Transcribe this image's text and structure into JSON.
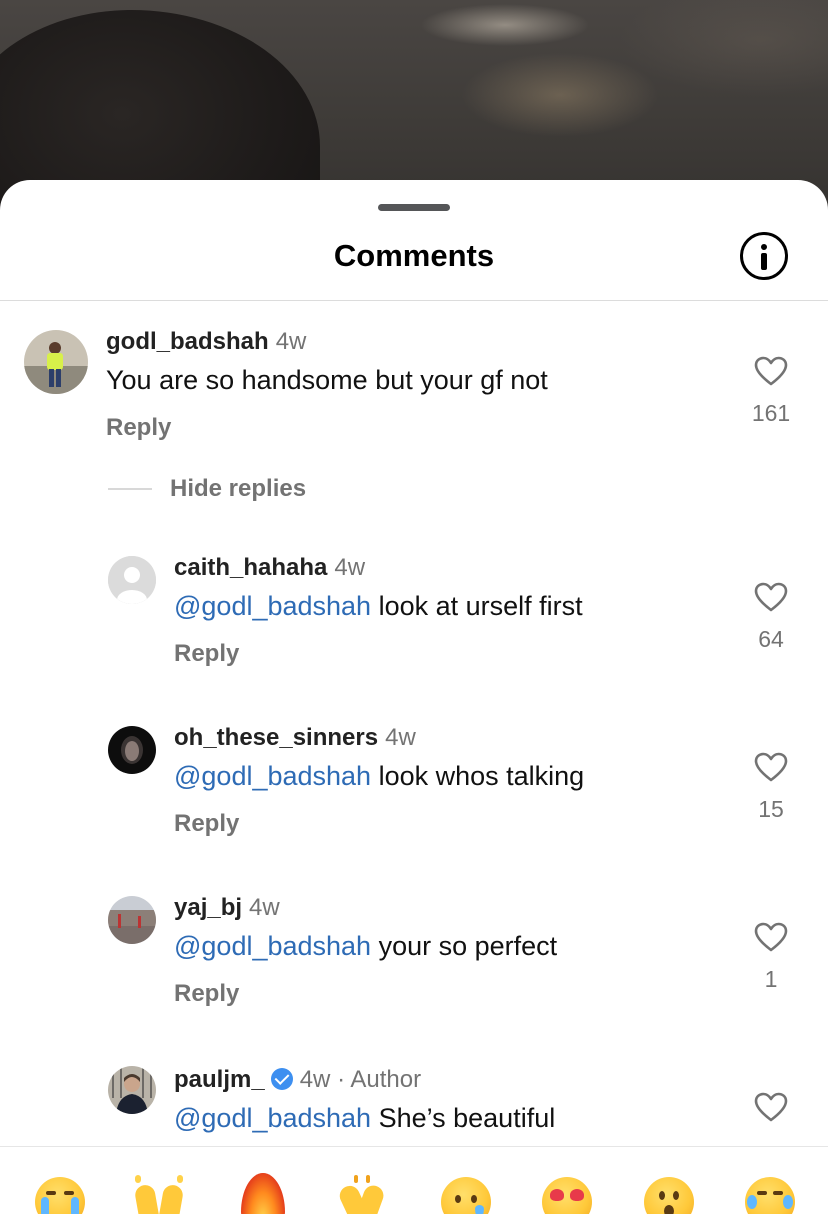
{
  "sheet": {
    "title": "Comments",
    "info_icon": "info-circle-icon"
  },
  "comments": [
    {
      "username": "godl_badshah",
      "time": "4w",
      "text": "You are so handsome but your gf not",
      "reply_label": "Reply",
      "likes": "161"
    }
  ],
  "hide_replies_label": "Hide replies",
  "replies": [
    {
      "username": "caith_hahaha",
      "time": "4w",
      "mention": "@godl_badshah",
      "text": " look at urself first",
      "reply_label": "Reply",
      "likes": "64"
    },
    {
      "username": "oh_these_sinners",
      "time": "4w",
      "mention": "@godl_badshah",
      "text": " look whos talking",
      "reply_label": "Reply",
      "likes": "15"
    },
    {
      "username": "yaj_bj",
      "time": "4w",
      "mention": "@godl_badshah",
      "text": " your so perfect",
      "reply_label": "Reply",
      "likes": "1"
    },
    {
      "username": "pauljm_",
      "time": "4w",
      "separator": "·",
      "author_badge": "Author",
      "verified_icon": "verified-badge-icon",
      "mention": "@godl_badshah",
      "text": " She’s beautiful"
    }
  ],
  "emoji_bar": [
    "loudly-crying-face-icon",
    "raising-hands-icon",
    "fire-icon",
    "clapping-hands-icon",
    "crying-face-icon",
    "heart-eyes-face-icon",
    "surprised-face-icon",
    "tears-of-joy-face-icon"
  ],
  "colors": {
    "mention": "#2e6bb5",
    "secondary_text": "#737373",
    "verified": "#3d8ff0"
  }
}
